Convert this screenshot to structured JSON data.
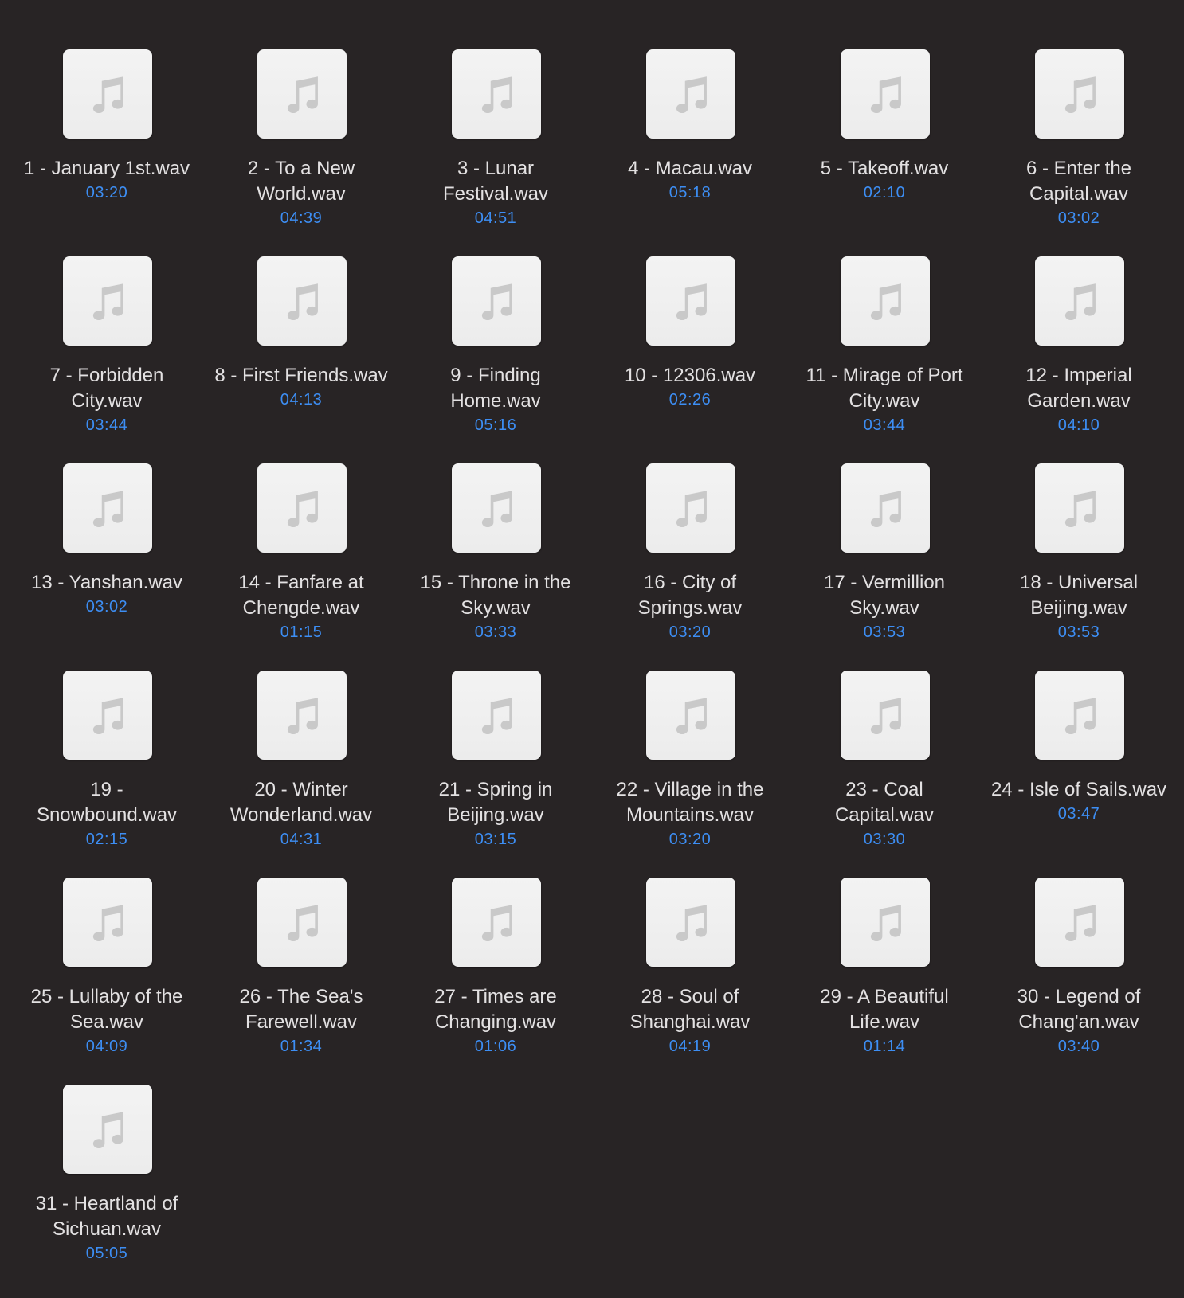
{
  "window": {
    "background": "#282425",
    "file_icon": "music-note-icon",
    "accent_color": "#3d8ef4"
  },
  "files": [
    {
      "name": "1 - January 1st.wav",
      "duration": "03:20"
    },
    {
      "name": "2 - To a New World.wav",
      "duration": "04:39"
    },
    {
      "name": "3 - Lunar Festival.wav",
      "duration": "04:51"
    },
    {
      "name": "4 - Macau.wav",
      "duration": "05:18"
    },
    {
      "name": "5 - Takeoff.wav",
      "duration": "02:10"
    },
    {
      "name": "6 - Enter the Capital.wav",
      "duration": "03:02"
    },
    {
      "name": "7 - Forbidden City.wav",
      "duration": "03:44"
    },
    {
      "name": "8 - First Friends.wav",
      "duration": "04:13"
    },
    {
      "name": "9 - Finding Home.wav",
      "duration": "05:16"
    },
    {
      "name": "10 - 12306.wav",
      "duration": "02:26"
    },
    {
      "name": "11 - Mirage of Port City.wav",
      "duration": "03:44"
    },
    {
      "name": "12 - Imperial Garden.wav",
      "duration": "04:10"
    },
    {
      "name": "13 - Yanshan.wav",
      "duration": "03:02"
    },
    {
      "name": "14 - Fanfare at Chengde.wav",
      "duration": "01:15"
    },
    {
      "name": "15 - Throne in the Sky.wav",
      "duration": "03:33"
    },
    {
      "name": "16 - City of Springs.wav",
      "duration": "03:20"
    },
    {
      "name": "17 - Vermillion Sky.wav",
      "duration": "03:53"
    },
    {
      "name": "18 - Universal Beijing.wav",
      "duration": "03:53"
    },
    {
      "name": "19 - Snowbound.wav",
      "duration": "02:15"
    },
    {
      "name": "20 - Winter Wonderland.wav",
      "duration": "04:31"
    },
    {
      "name": "21 - Spring in Beijing.wav",
      "duration": "03:15"
    },
    {
      "name": "22 - Village in the Mountains.wav",
      "duration": "03:20"
    },
    {
      "name": "23 - Coal Capital.wav",
      "duration": "03:30"
    },
    {
      "name": "24 - Isle of Sails.wav",
      "duration": "03:47"
    },
    {
      "name": "25 - Lullaby of the Sea.wav",
      "duration": "04:09"
    },
    {
      "name": "26 - The Sea's Farewell.wav",
      "duration": "01:34"
    },
    {
      "name": "27 - Times are Changing.wav",
      "duration": "01:06"
    },
    {
      "name": "28 - Soul of Shanghai.wav",
      "duration": "04:19"
    },
    {
      "name": "29 - A Beautiful Life.wav",
      "duration": "01:14"
    },
    {
      "name": "30 - Legend of Chang'an.wav",
      "duration": "03:40"
    },
    {
      "name": "31 - Heartland of Sichuan.wav",
      "duration": "05:05"
    }
  ]
}
